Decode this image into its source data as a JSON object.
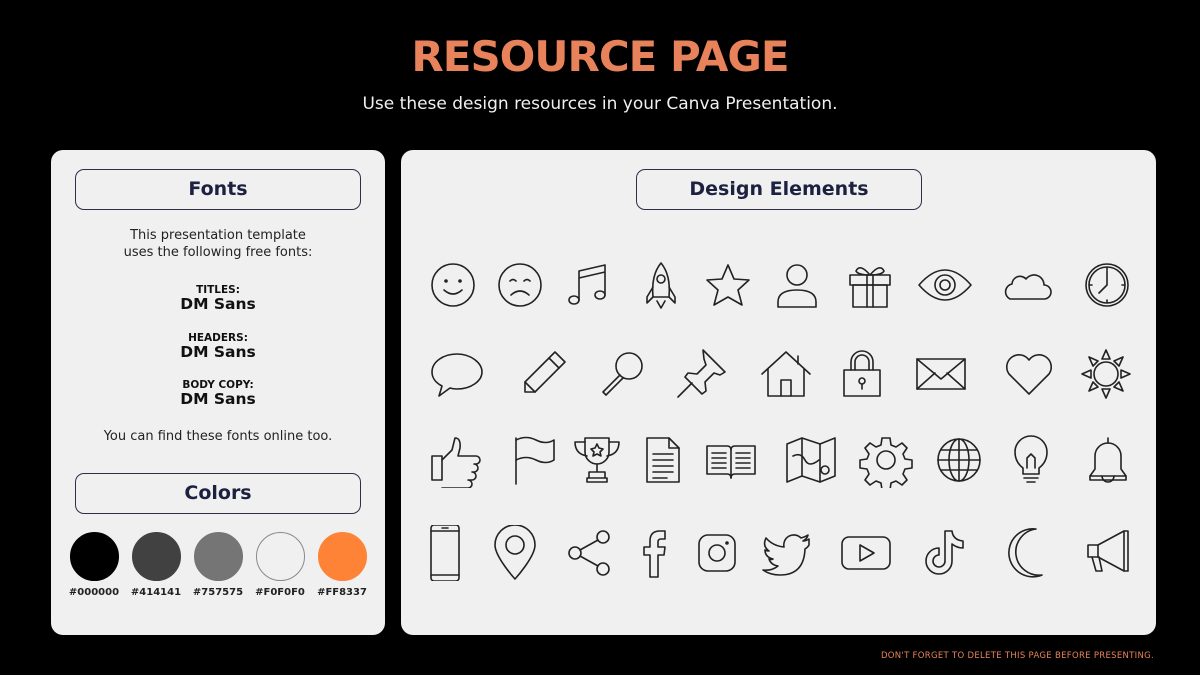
{
  "header": {
    "title": "RESOURCE PAGE",
    "subtitle": "Use these design resources in your Canva Presentation."
  },
  "fonts_panel": {
    "heading": "Fonts",
    "intro_line1": "This presentation template",
    "intro_line2": "uses the following free fonts:",
    "items": [
      {
        "label": "TITLES:",
        "font": "DM Sans"
      },
      {
        "label": "HEADERS:",
        "font": "DM Sans"
      },
      {
        "label": "BODY COPY:",
        "font": "DM Sans"
      }
    ],
    "note": "You can find these fonts online too."
  },
  "colors_panel": {
    "heading": "Colors",
    "swatches": [
      {
        "hex": "#000000",
        "label": "#000000"
      },
      {
        "hex": "#414141",
        "label": "#414141"
      },
      {
        "hex": "#757575",
        "label": "#757575"
      },
      {
        "hex": "#F0F0F0",
        "label": "#F0F0F0"
      },
      {
        "hex": "#FF8337",
        "label": "#FF8337"
      }
    ]
  },
  "design_panel": {
    "heading": "Design Elements",
    "icons": [
      [
        "smiley-face-icon",
        "sad-face-icon",
        "music-note-icon",
        "rocket-icon",
        "star-icon",
        "user-icon",
        "gift-icon",
        "eye-icon",
        "cloud-icon",
        "clock-icon"
      ],
      [
        "speech-bubble-icon",
        "pencil-icon",
        "magnifier-icon",
        "pushpin-icon",
        "house-icon",
        "padlock-icon",
        "envelope-icon",
        "heart-icon",
        "sun-icon"
      ],
      [
        "thumbs-up-icon",
        "flag-icon",
        "trophy-icon",
        "document-icon",
        "open-book-icon",
        "map-icon",
        "gear-icon",
        "globe-icon",
        "lightbulb-icon",
        "bell-icon"
      ],
      [
        "smartphone-icon",
        "location-pin-icon",
        "share-icon",
        "facebook-icon",
        "instagram-icon",
        "twitter-icon",
        "youtube-icon",
        "tiktok-icon",
        "crescent-moon-icon",
        "megaphone-icon"
      ]
    ]
  },
  "footer": {
    "note": "DON'T FORGET TO DELETE THIS PAGE BEFORE PRESENTING."
  },
  "colors": {
    "background": "#000000",
    "accent": "#E8825B",
    "panel": "#F0F0F0",
    "pill_border": "#2C2F4A"
  }
}
